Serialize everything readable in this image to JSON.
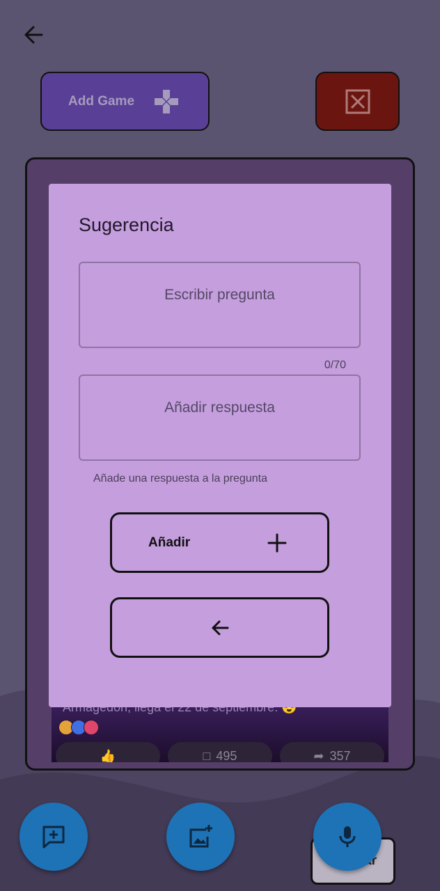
{
  "header": {
    "back_icon": "arrow-left-icon"
  },
  "toolbar": {
    "add_game_label": "Add Game",
    "add_game_icon": "gamepad-icon",
    "close_icon": "close-box-icon"
  },
  "post": {
    "text": "Armagedon, llega el 22 de septiembre. 😍",
    "comments": "495",
    "shares": "357"
  },
  "dialog": {
    "title": "Sugerencia",
    "question_placeholder": "Escribir pregunta",
    "counter": "0/70",
    "answer_placeholder": "Añadir respuesta",
    "helper_text": "Añade una respuesta a la pregunta",
    "add_label": "Añadir",
    "add_icon": "plus-icon",
    "back_icon": "arrow-left-icon"
  },
  "bottom": {
    "fab_icons": [
      "add-comment-icon",
      "add-photo-icon",
      "microphone-icon"
    ],
    "partial_button_label": "ar"
  },
  "colors": {
    "background": "#5b5470",
    "dialog": "#c59ede",
    "add_game": "#5a3f96",
    "close": "#6b1510",
    "fab": "#1d73b6"
  }
}
